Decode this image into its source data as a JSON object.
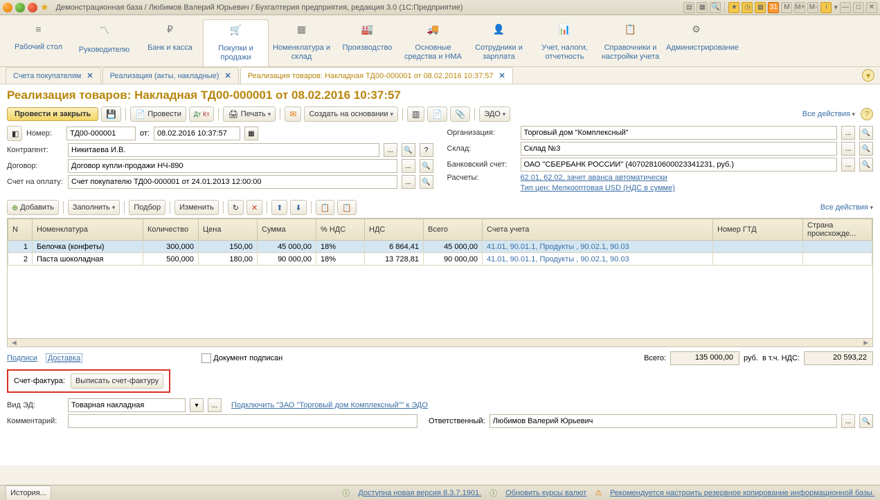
{
  "titlebar": {
    "text": "Демонстрационная база / Любимов Валерий Юрьевич / Бухгалтерия предприятия, редакция 3.0  (1С:Предприятие)",
    "right_icons": [
      "M",
      "M+",
      "M-"
    ],
    "info": "i"
  },
  "nav": [
    {
      "icon": "≡",
      "label": "Рабочий стол"
    },
    {
      "icon": "〽",
      "label": "Руководителю"
    },
    {
      "icon": "₽",
      "label": "Банк и касса"
    },
    {
      "icon": "🛒",
      "label": "Покупки и продажи"
    },
    {
      "icon": "▦",
      "label": "Номенклатура и склад"
    },
    {
      "icon": "🏭",
      "label": "Производство"
    },
    {
      "icon": "🚚",
      "label": "Основные средства и НМА"
    },
    {
      "icon": "👤",
      "label": "Сотрудники и зарплата"
    },
    {
      "icon": "📊",
      "label": "Учет, налоги, отчетность"
    },
    {
      "icon": "📋",
      "label": "Справочники и настройки учета"
    },
    {
      "icon": "⚙",
      "label": "Администрирование"
    }
  ],
  "tabs": [
    {
      "label": "Счета покупателям",
      "closable": true
    },
    {
      "label": "Реализация (акты, накладные)",
      "closable": true
    },
    {
      "label": "Реализация товаров: Накладная ТД00-000001 от 08.02.2016 10:37:57",
      "closable": true,
      "active": true
    }
  ],
  "doc": {
    "title": "Реализация товаров: Накладная ТД00-000001 от 08.02.2016 10:37:57",
    "toolbar": {
      "post_close": "Провести и закрыть",
      "post": "Провести",
      "print": "Печать",
      "create_based": "Создать на основании",
      "edo": "ЭДО",
      "all_actions": "Все действия"
    },
    "fields": {
      "number_label": "Номер:",
      "number": "ТД00-000001",
      "from_label": "от:",
      "date": "08.02.2016 10:37:57",
      "org_label": "Организация:",
      "org": "Торговый дом \"Комплексный\"",
      "counterparty_label": "Контрагент:",
      "counterparty": "Никитаева И.В.",
      "warehouse_label": "Склад:",
      "warehouse": "Склад №3",
      "contract_label": "Договор:",
      "contract": "Договор купли-продажи НЧ-890",
      "bank_label": "Банковский счет:",
      "bank": "ОАО \"СБЕРБАНК РОССИИ\" (40702810600023341231, руб.)",
      "invoice_label": "Счет на оплату:",
      "invoice": "Счет покупателю ТД00-000001 от 24.01.2013 12:00:00",
      "calc_label": "Расчеты:",
      "calc_link": "62.01, 62.02, зачет аванса автоматически",
      "price_type_link": "Тип цен: Мелкооптовая USD (НДС в сумме)"
    },
    "grid_toolbar": {
      "add": "Добавить",
      "fill": "Заполнить",
      "select": "Подбор",
      "change": "Изменить",
      "all_actions": "Все действия"
    },
    "grid": {
      "headers": [
        "N",
        "Номенклатура",
        "Количество",
        "Цена",
        "Сумма",
        "% НДС",
        "НДС",
        "Всего",
        "Счета учета",
        "Номер ГТД",
        "Страна происхожде..."
      ],
      "rows": [
        {
          "n": "1",
          "name": "Белочка (конфеты)",
          "qty": "300,000",
          "price": "150,00",
          "sum": "45 000,00",
          "vat_rate": "18%",
          "vat": "6 864,41",
          "total": "45 000,00",
          "accounts": "41.01, 90.01.1, Продукты , 90.02.1, 90.03"
        },
        {
          "n": "2",
          "name": "Паста шоколадная",
          "qty": "500,000",
          "price": "180,00",
          "sum": "90 000,00",
          "vat_rate": "18%",
          "vat": "13 728,81",
          "total": "90 000,00",
          "accounts": "41.01, 90.01.1, Продукты , 90.02.1, 90.03"
        }
      ]
    },
    "footer": {
      "signatures": "Подписи",
      "delivery": "Доставка",
      "signed": "Документ подписан",
      "total_label": "Всего:",
      "total": "135 000,00",
      "currency": "руб.",
      "vat_inc_label": "в т.ч. НДС:",
      "vat_inc": "20 593,22",
      "invoice_label": "Счет-фактура:",
      "invoice_btn": "Выписать счет-фактуру",
      "ed_type_label": "Вид ЭД:",
      "ed_type": "Товарная накладная",
      "edo_link": "Подключить \"ЗАО \"Торговый дом Комплексный\"\" к ЭДО",
      "comment_label": "Комментарий:",
      "comment": "",
      "responsible_label": "Ответственный:",
      "responsible": "Любимов Валерий Юрьевич"
    }
  },
  "statusbar": {
    "history": "История...",
    "version": "Доступна новая версия 8.3.7.1901.",
    "rates": "Обновить курсы валют",
    "backup": "Рекомендуется настроить резервное копирование информационной базы."
  }
}
